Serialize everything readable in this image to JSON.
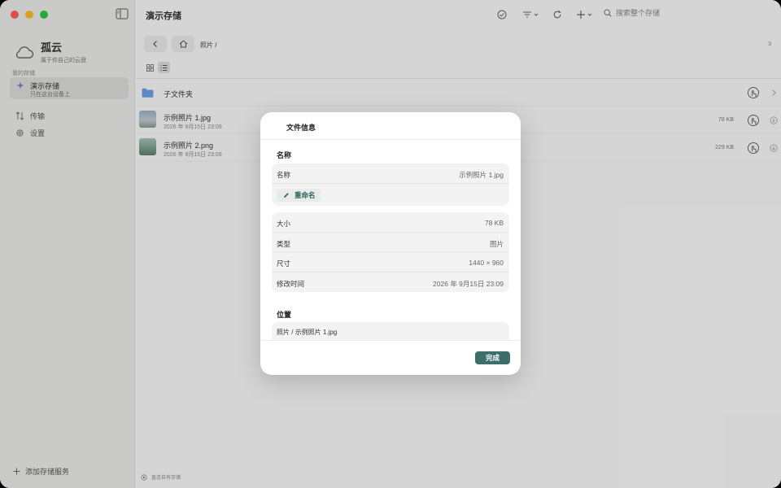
{
  "colors": {
    "accent": "#3d6e6a",
    "sidebar_bg": "#ececea",
    "traffic_close": "#ff5f57",
    "traffic_min": "#febc2e",
    "traffic_max": "#28c840"
  },
  "sidebar": {
    "app_name": "孤云",
    "app_subtitle": "属于你自己的云盘",
    "section_label": "我的存储",
    "storage": {
      "name": "演示存储",
      "subtitle": "只在这台设备上"
    },
    "nav": [
      {
        "label": "传输",
        "icon": "transfer-icon"
      },
      {
        "label": "设置",
        "icon": "gear-icon"
      }
    ],
    "add_service_label": "添加存储服务"
  },
  "toolbar": {
    "title": "演示存储",
    "search_placeholder": "搜索整个存储"
  },
  "pathbar": {
    "path": "照片 /",
    "count": "3"
  },
  "files": [
    {
      "type": "folder",
      "name": "子文件夹"
    },
    {
      "type": "image",
      "name": "示例照片 1.jpg",
      "date": "2026 年 9月15日 23:09",
      "size": "78 KB"
    },
    {
      "type": "image",
      "name": "示例照片 2.png",
      "date": "2026 年 9月15日 23:09",
      "size": "229 KB"
    }
  ],
  "status_bar": {
    "text": "直连自有存储"
  },
  "modal": {
    "title": "文件信息",
    "name_section": "名称",
    "name_key": "名称",
    "name_value": "示例照片 1.jpg",
    "rename_label": "重命名",
    "details": [
      {
        "key": "大小",
        "value": "78 KB"
      },
      {
        "key": "类型",
        "value": "图片"
      },
      {
        "key": "尺寸",
        "value": "1440 × 960"
      },
      {
        "key": "修改时间",
        "value": "2026 年 9月15日 23:09"
      }
    ],
    "location_section": "位置",
    "location_value": "照片 / 示例照片 1.jpg",
    "done_label": "完成"
  }
}
